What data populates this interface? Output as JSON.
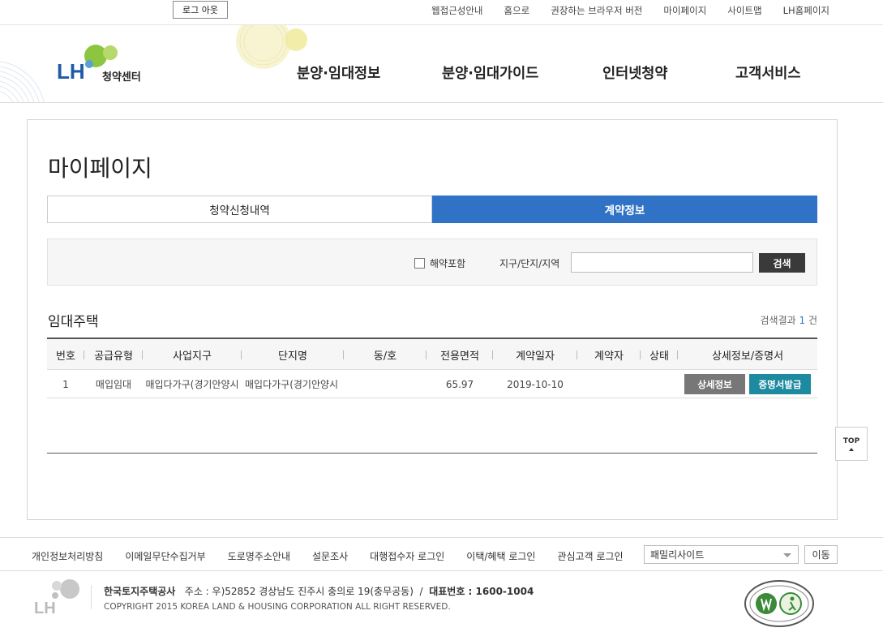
{
  "util": {
    "logout": "로그 아웃",
    "links": [
      "웹접근성안내",
      "홈으로",
      "권장하는 브라우저 버전",
      "마이페이지",
      "사이트맵",
      "LH홈페이지"
    ]
  },
  "header": {
    "logo_text": "청약센터",
    "nav": [
      "분양·임대정보",
      "분양·임대가이드",
      "인터넷청약",
      "고객서비스"
    ]
  },
  "main": {
    "title": "마이페이지",
    "tabs": [
      {
        "label": "청약신청내역",
        "active": false
      },
      {
        "label": "계약정보",
        "active": true
      }
    ],
    "search": {
      "checkbox_label": "해약포함",
      "region_label": "지구/단지/지역",
      "region_value": "",
      "button": "검색"
    },
    "section_title": "임대주택",
    "result_prefix": "검색결과",
    "result_count": "1",
    "result_suffix": "건",
    "table": {
      "headers": [
        "번호",
        "공급유형",
        "사업지구",
        "단지명",
        "동/호",
        "전용면적",
        "계약일자",
        "계약자",
        "상태",
        "상세정보/증명서"
      ],
      "rows": [
        {
          "no": "1",
          "type": "매입임대",
          "district": "매입다가구(경기안양시",
          "complex": "매입다가구(경기안양시",
          "unit": "",
          "area": "65.97",
          "date": "2019-10-10",
          "contractor": "",
          "status": "",
          "btn_detail": "상세정보",
          "btn_cert": "증명서발급"
        }
      ]
    }
  },
  "top_button": "TOP",
  "footer": {
    "links": [
      "개인정보처리방침",
      "이메일무단수집거부",
      "도로명주소안내",
      "설문조사",
      "대행접수자 로그인",
      "이택/혜택 로그인",
      "관심고객 로그인"
    ],
    "family_site": "패밀리사이트",
    "go": "이동",
    "company": "한국토지주택공사",
    "address": "주소 : 우)52852 경상남도 진주시 충의로 19(충무공동)",
    "sep": "/",
    "rep_label": "대표번호 : 1600-1004",
    "copyright": "COPYRIGHT 2015 KOREA LAND & HOUSING CORPORATION ALL RIGHT RESERVED."
  },
  "colors": {
    "accent": "#2f72c6",
    "cert_button": "#1d8aa0",
    "detail_button": "#777777",
    "search_button": "#3a3a3a",
    "logo_blue": "#1f5aa6",
    "logo_green": "#8cc63f"
  }
}
